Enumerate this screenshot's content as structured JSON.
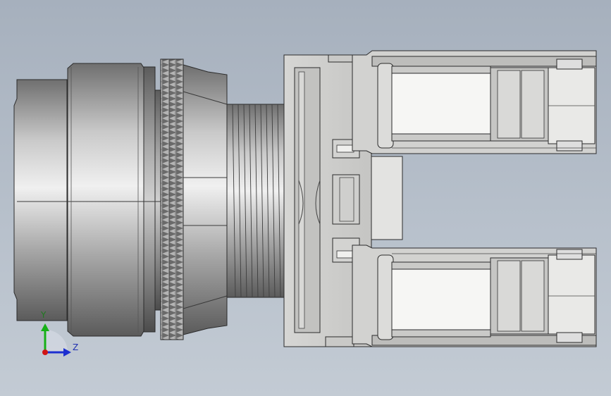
{
  "viewport": {
    "background_top": "#a6b0bd",
    "background_bottom": "#c3cbd4"
  },
  "model": {
    "description_icon": "push-button-switch-model",
    "body_color": "#c8c8c8",
    "edge_color": "#2b2b2b",
    "knurl_color": "#a9a9a9"
  },
  "triad": {
    "y_label": "Y",
    "z_label": "Z",
    "y_color": "#16b016",
    "z_color": "#1c2fd0",
    "x_color": "#d01414"
  }
}
